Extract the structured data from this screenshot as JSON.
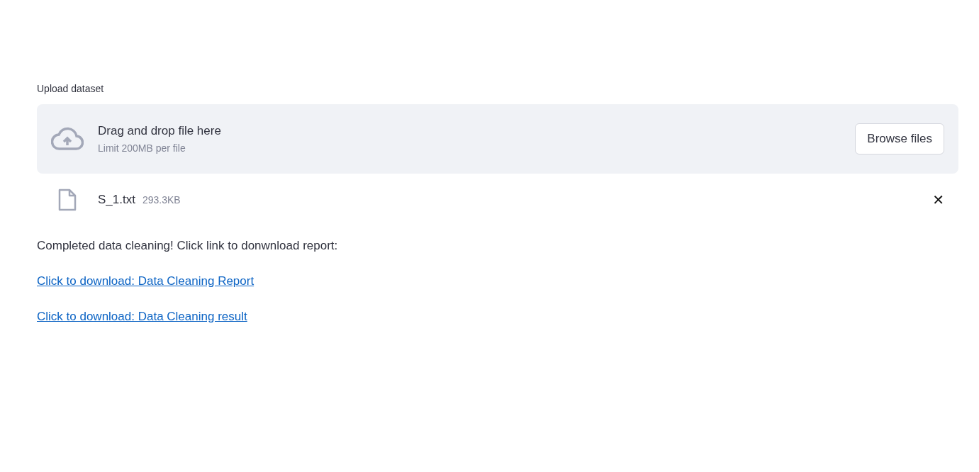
{
  "uploader": {
    "label": "Upload dataset",
    "dropzone": {
      "title": "Drag and drop file here",
      "hint": "Limit 200MB per file",
      "button": "Browse files"
    },
    "files": [
      {
        "name": "S_1.txt",
        "size": "293.3KB",
        "remove": "✕"
      }
    ]
  },
  "message": "Completed data cleaning! Click link to donwnload report:",
  "links": [
    "Click to download: Data Cleaning Report",
    "Click to download: Data Cleaning result"
  ]
}
